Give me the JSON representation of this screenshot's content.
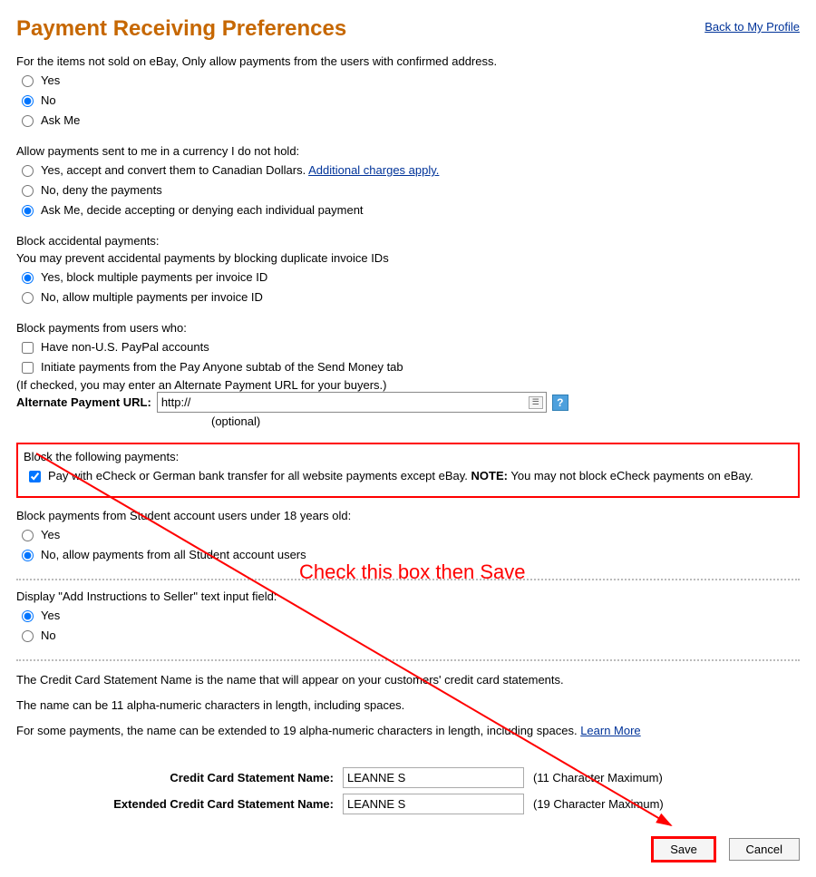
{
  "header": {
    "title": "Payment Receiving Preferences",
    "back_link": "Back to My Profile"
  },
  "confirmed_address": {
    "question": "For the items not sold on eBay, Only allow payments from the users with confirmed address.",
    "opt_yes": "Yes",
    "opt_no": "No",
    "opt_ask": "Ask Me",
    "selected": "No"
  },
  "currency": {
    "question": "Allow payments sent to me in a currency I do not hold:",
    "opt_yes_prefix": "Yes, accept and convert them to Canadian Dollars. ",
    "opt_yes_link": "Additional charges apply.",
    "opt_no": "No, deny the payments",
    "opt_ask": "Ask Me, decide accepting or denying each individual payment",
    "selected": "ask"
  },
  "block_accidental": {
    "question": "Block accidental payments:",
    "sub": "You may prevent accidental payments by blocking duplicate invoice IDs",
    "opt_yes": "Yes, block multiple payments per invoice ID",
    "opt_no": "No, allow multiple payments per invoice ID",
    "selected": "yes"
  },
  "block_users": {
    "question": "Block payments from users who:",
    "opt1": "Have non-U.S. PayPal accounts",
    "opt2": "Initiate payments from the Pay Anyone subtab of the Send Money tab",
    "opt1_checked": false,
    "opt2_checked": false,
    "hint": "(If checked, you may enter an Alternate Payment URL for your buyers.)",
    "url_label": "Alternate Payment URL:",
    "url_value": "http://",
    "optional": "(optional)"
  },
  "block_following": {
    "question": "Block the following payments:",
    "opt_label_prefix": "Pay with eCheck or German bank transfer for all website payments except eBay. ",
    "opt_note_label": "NOTE:",
    "opt_note_text": " You may not block eCheck payments on eBay.",
    "checked": true
  },
  "block_student": {
    "question": "Block payments from Student account users under 18 years old:",
    "opt_yes": "Yes",
    "opt_no": "No, allow payments from all Student account users",
    "selected": "no"
  },
  "display_instructions": {
    "question": "Display \"Add Instructions to Seller\" text input field:",
    "opt_yes": "Yes",
    "opt_no": "No",
    "selected": "yes"
  },
  "cc": {
    "desc1": "The Credit Card Statement Name is the name that will appear on your customers' credit card statements.",
    "desc2": "The name can be 11 alpha-numeric characters in length, including spaces.",
    "desc3_prefix": "For some payments, the name can be extended to 19 alpha-numeric characters in length, including spaces. ",
    "desc3_link": "Learn More",
    "label1": "Credit Card Statement Name:",
    "value1": "LEANNE S",
    "max1": "(11 Character Maximum)",
    "label2": "Extended Credit Card Statement Name:",
    "value2": "LEANNE S",
    "max2": "(19 Character Maximum)"
  },
  "buttons": {
    "save": "Save",
    "cancel": "Cancel"
  },
  "annotation": {
    "text": "Check this box then Save"
  }
}
